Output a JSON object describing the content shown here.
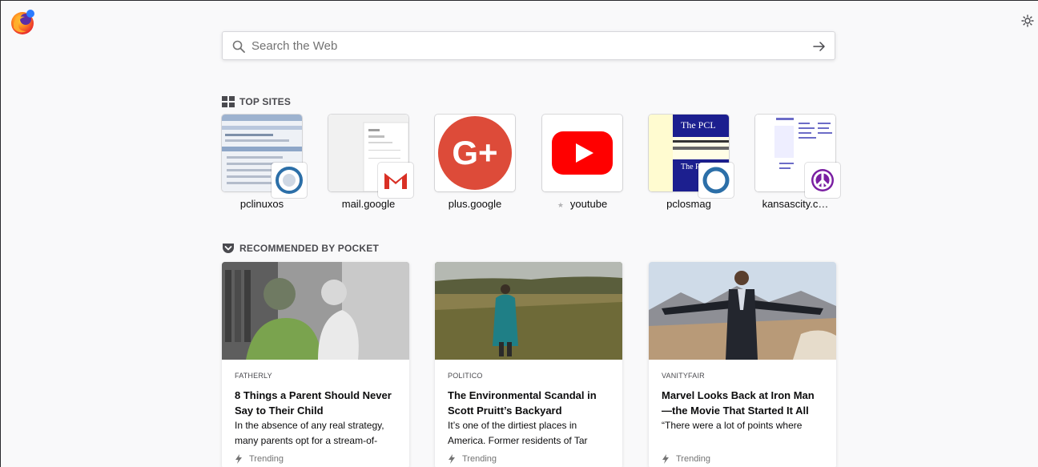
{
  "search": {
    "placeholder": "Search the Web"
  },
  "top_sites": {
    "title": "TOP SITES",
    "items": [
      {
        "label": "pclinuxos",
        "icon": "pclinuxos-icon"
      },
      {
        "label": "mail.google",
        "icon": "gmail-icon"
      },
      {
        "label": "plus.google",
        "icon": "google-plus-icon"
      },
      {
        "label": "youtube",
        "icon": "youtube-icon",
        "pinned": true
      },
      {
        "label": "pclosmag",
        "icon": "pclosmag-icon"
      },
      {
        "label": "kansascity.c…",
        "icon": "peace-icon"
      }
    ]
  },
  "pocket": {
    "title": "RECOMMENDED BY POCKET",
    "cards": [
      {
        "source": "FATHERLY",
        "title": "8 Things a Parent Should Never Say to Their Child",
        "excerpt": "In the absence of any real strategy, many parents opt for a stream-of-",
        "context": "Trending"
      },
      {
        "source": "POLITICO",
        "title": "The Environmental Scandal in Scott Pruitt’s Backyard",
        "excerpt": "It’s one of the dirtiest places in America. Former residents of Tar",
        "context": "Trending"
      },
      {
        "source": "VANITYFAIR",
        "title": "Marvel Looks Back at Iron Man—the Movie That Started It All",
        "excerpt": "“There were a lot of points where",
        "context": "Trending"
      }
    ]
  },
  "colors": {
    "background": "#f9f9fa",
    "gplus_red": "#dd4b39",
    "youtube_red": "#ff0000",
    "gmail_red": "#d93025",
    "peace_purple": "#7a1fa2"
  }
}
